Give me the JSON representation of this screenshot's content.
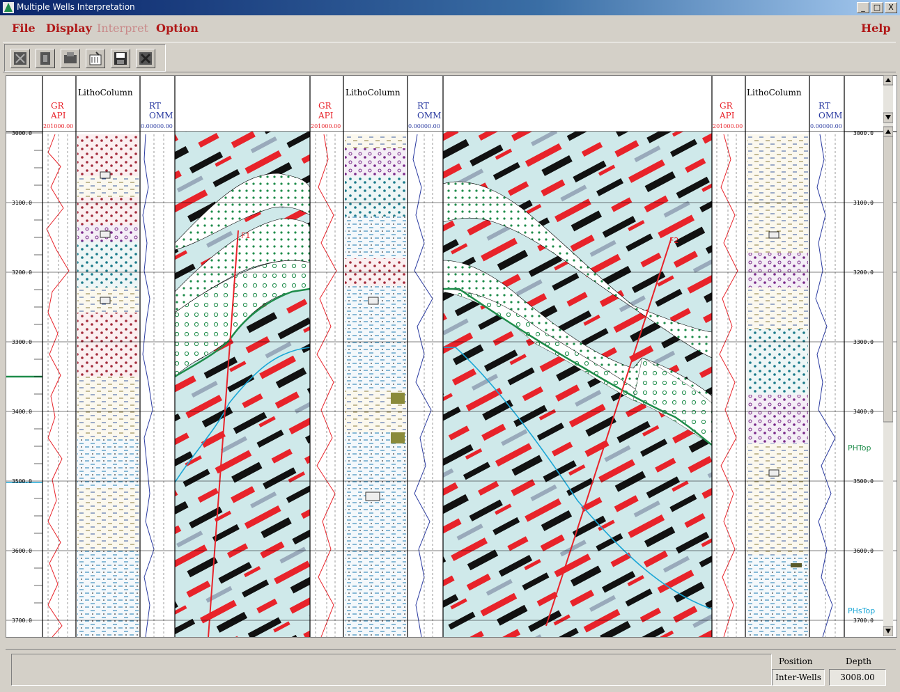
{
  "window": {
    "title": "Multiple Wells Interpretation",
    "buttons": [
      "_",
      "□",
      "X"
    ]
  },
  "menu": {
    "file": "File",
    "display": "Display",
    "interpret": "Interpret",
    "option": "Option",
    "help": "Help"
  },
  "toolbar": {
    "icons": [
      "zoom-icon",
      "cursor-icon",
      "print-icon",
      "open-icon",
      "save-icon",
      "exit-icon"
    ]
  },
  "tracks": {
    "gr_label": "GR",
    "gr_unit": "API",
    "gr_scale": "201000.00",
    "litho_label": "LithoColumn",
    "rt_label": "RT",
    "rt_unit": "OMM",
    "rt_scale": "0.00000.00"
  },
  "depth": {
    "ticks": [
      "3000.0",
      "3100.0",
      "3200.0",
      "3300.0",
      "3400.0",
      "3500.0",
      "3600.0",
      "3700.0"
    ]
  },
  "faults": {
    "f1": "F1",
    "f2": "F2"
  },
  "horizons": {
    "phtop": "PHTop",
    "phstop": "PHsTop"
  },
  "colors": {
    "red": "#e8232a",
    "green": "#1e8c4a",
    "cyan": "#1aa6d6",
    "seis_bg": "#cfe9ea"
  },
  "status": {
    "position_label": "Position",
    "depth_label": "Depth",
    "position_value": "Inter-Wells",
    "depth_value": "3008.00"
  }
}
